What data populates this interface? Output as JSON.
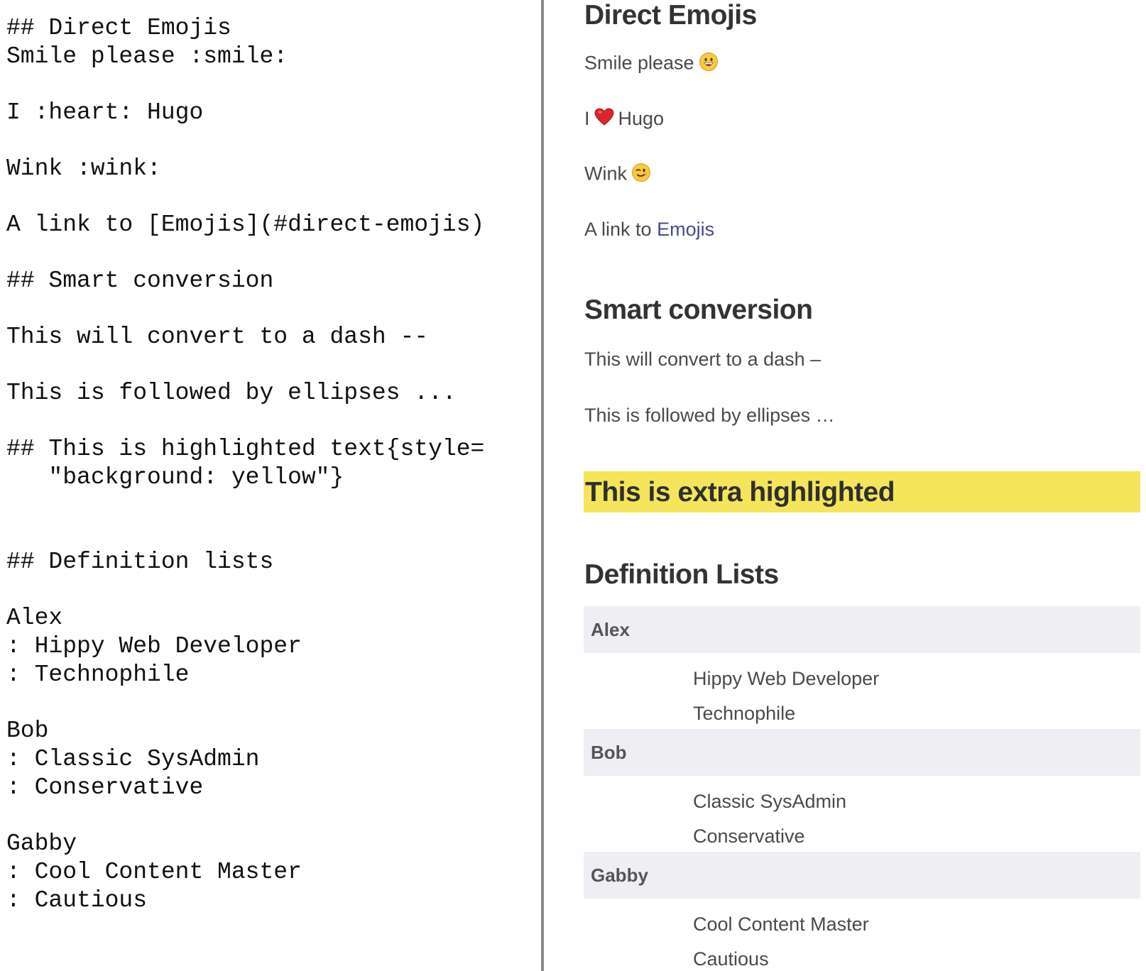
{
  "source": {
    "lines": [
      "## Direct Emojis",
      "Smile please :smile:",
      "I :heart: Hugo",
      "Wink :wink:",
      "A link to [Emojis](#direct-emojis)",
      "## Smart conversion",
      "This will convert to a dash --",
      "This is followed by ellipses ...",
      "## This is highlighted text{style=",
      "   \"background: yellow\"}",
      "## Definition lists",
      "Alex",
      ": Hippy Web Developer",
      ": Technophile",
      "Bob",
      ": Classic SysAdmin",
      ": Conservative",
      "Gabby",
      ": Cool Content Master",
      ": Cautious"
    ]
  },
  "preview": {
    "emojis_heading": "Direct Emojis",
    "smile_text": "Smile please",
    "heart_pre": "I",
    "heart_post": "Hugo",
    "wink_text": "Wink",
    "link_pre": "A link to",
    "link_text": "Emojis",
    "smart_heading": "Smart conversion",
    "dash_text": "This will convert to a dash –",
    "ellipses_text": "This is followed by ellipses …",
    "highlight_heading": "This is extra highlighted",
    "deflist_heading": "Definition Lists",
    "definitions": [
      {
        "term": "Alex",
        "items": [
          "Hippy Web Developer",
          "Technophile"
        ]
      },
      {
        "term": "Bob",
        "items": [
          "Classic SysAdmin",
          "Conservative"
        ]
      },
      {
        "term": "Gabby",
        "items": [
          "Cool Content Master",
          "Cautious"
        ]
      }
    ]
  },
  "colors": {
    "highlight": "#f4e55a",
    "dt_background": "#efeef3",
    "link": "#4a4a8c",
    "divider": "#8a8a8a"
  },
  "icons": [
    "smile-emoji-icon",
    "heart-emoji-icon",
    "wink-emoji-icon"
  ]
}
